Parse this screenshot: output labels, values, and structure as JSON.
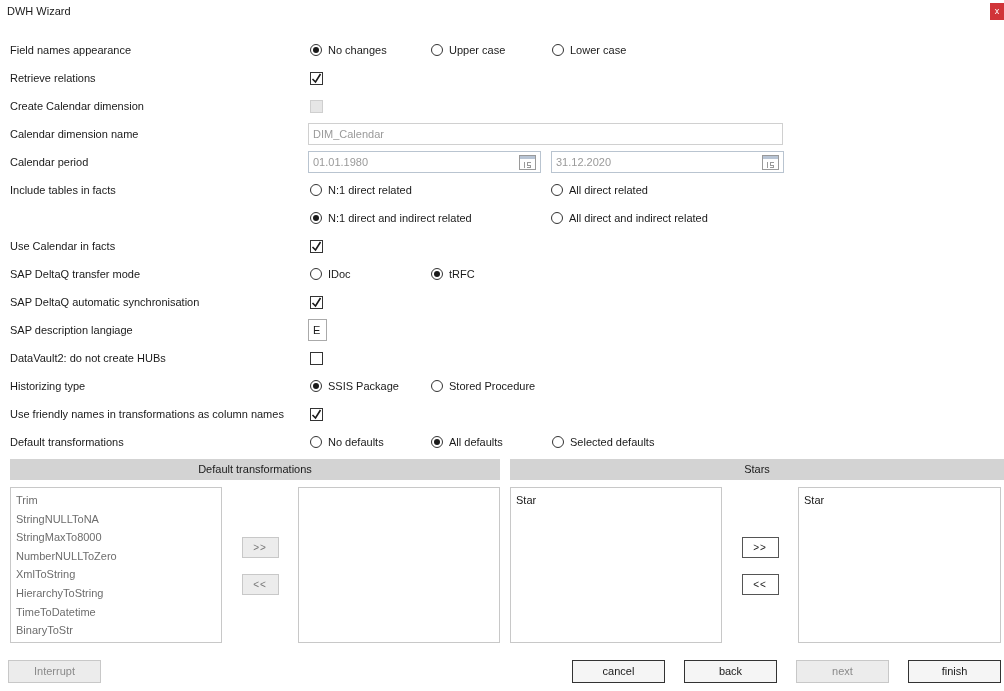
{
  "window": {
    "title": "DWH Wizard",
    "close": "x"
  },
  "settings": [
    {
      "kind": "radio",
      "label": "Field names appearance",
      "options": [
        {
          "label": "No changes",
          "selected": true
        },
        {
          "label": "Upper case",
          "selected": false
        },
        {
          "label": "Lower case",
          "selected": false
        }
      ]
    },
    {
      "kind": "checkbox",
      "label": "Retrieve relations",
      "checked": true,
      "disabled": false
    },
    {
      "kind": "checkbox",
      "label": "Create Calendar dimension",
      "checked": false,
      "disabled": true
    },
    {
      "kind": "text",
      "label": "Calendar dimension name",
      "value": "DIM_Calendar",
      "disabled": true
    },
    {
      "kind": "dates",
      "label": "Calendar period",
      "from": "01.01.1980",
      "to": "31.12.2020",
      "disabled": true
    },
    {
      "kind": "radio-pairs",
      "label": "Include tables in facts",
      "options": [
        {
          "label": "N:1 direct related",
          "selected": false
        },
        {
          "label": "All direct related",
          "selected": false
        },
        {
          "label": "N:1 direct and indirect related",
          "selected": true
        },
        {
          "label": "All direct and indirect related",
          "selected": false
        }
      ]
    },
    {
      "kind": "checkbox",
      "label": "Use Calendar in facts",
      "checked": true,
      "disabled": false
    },
    {
      "kind": "radio",
      "label": "SAP DeltaQ transfer mode",
      "options": [
        {
          "label": "IDoc",
          "selected": false
        },
        {
          "label": "tRFC",
          "selected": true
        }
      ]
    },
    {
      "kind": "checkbox",
      "label": "SAP DeltaQ automatic synchronisation",
      "checked": true,
      "disabled": false
    },
    {
      "kind": "letter",
      "label": "SAP description langiage",
      "value": "E"
    },
    {
      "kind": "checkbox",
      "label": "DataVault2: do not create HUBs",
      "checked": false,
      "disabled": false
    },
    {
      "kind": "radio",
      "label": "Historizing type",
      "options": [
        {
          "label": "SSIS Package",
          "selected": true
        },
        {
          "label": "Stored Procedure",
          "selected": false
        }
      ]
    },
    {
      "kind": "checkbox",
      "label": "Use friendly names in transformations as column names",
      "checked": true,
      "disabled": false
    },
    {
      "kind": "radio",
      "label": "Default transformations",
      "options": [
        {
          "label": "No defaults",
          "selected": false
        },
        {
          "label": "All defaults",
          "selected": true
        },
        {
          "label": "Selected defaults",
          "selected": false
        }
      ]
    }
  ],
  "panels": [
    {
      "title": "Default transformations",
      "disabled": true,
      "available": [
        "Trim",
        "StringNULLToNA",
        "StringMaxTo8000",
        "NumberNULLToZero",
        "XmlToString",
        "HierarchyToString",
        "TimeToDatetime",
        "BinaryToStr"
      ],
      "add": ">>",
      "remove": "<<"
    },
    {
      "title": "Stars",
      "disabled": false,
      "available": [
        "Star"
      ],
      "selected_items": [
        "Star"
      ],
      "add": ">>",
      "remove": "<<"
    }
  ],
  "buttons": [
    {
      "label": "Interrupt",
      "disabled": true
    },
    {
      "label": "cancel",
      "disabled": false
    },
    {
      "label": "back",
      "disabled": false
    },
    {
      "label": "next",
      "disabled": true
    },
    {
      "label": "finish",
      "disabled": false
    }
  ]
}
